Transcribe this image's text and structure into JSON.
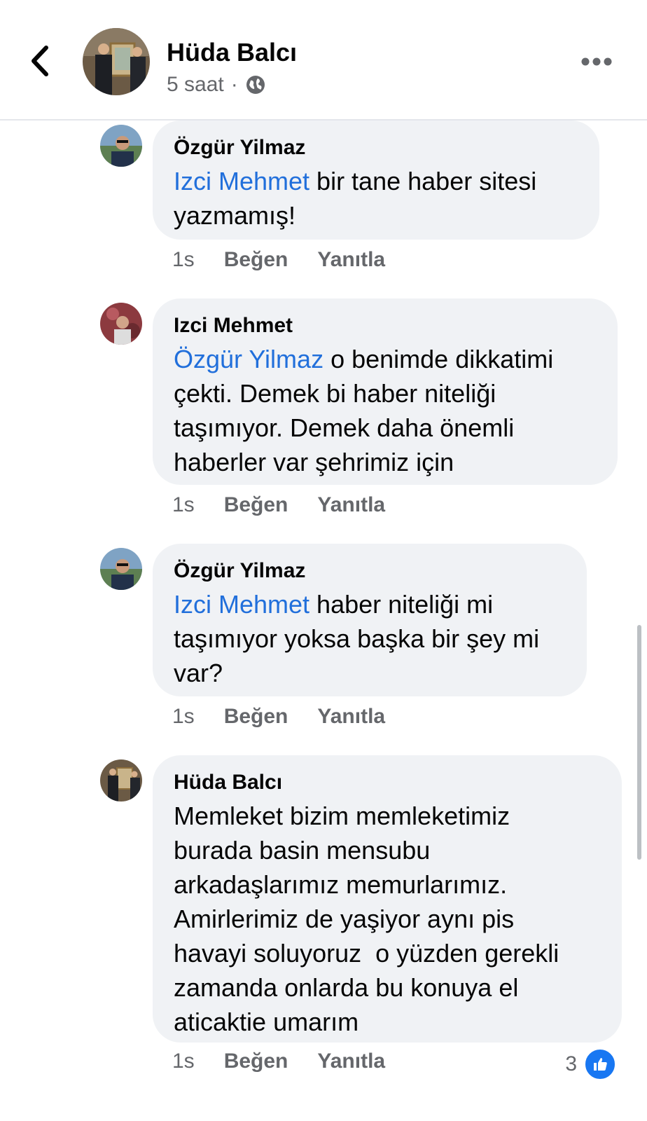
{
  "header": {
    "title": "Hüda Balcı",
    "time": "5 saat",
    "separator": "·",
    "privacy_icon": "globe-icon",
    "back_icon": "chevron-left-icon",
    "more_icon": "more-horizontal-icon"
  },
  "comments": [
    {
      "author": "Özgür Yilmaz",
      "mention": "Izci Mehmet",
      "text": " bir tane haber sitesi\nyazmamış!",
      "time": "1s",
      "like_label": "Beğen",
      "reply_label": "Yanıtla"
    },
    {
      "author": "Izci Mehmet",
      "mention": "Özgür Yilmaz",
      "text": " o benimde dikkatimi\nçekti. Demek bi haber niteliği\ntaşımıyor. Demek daha önemli\nhaberler var şehrimiz için",
      "time": "1s",
      "like_label": "Beğen",
      "reply_label": "Yanıtla"
    },
    {
      "author": "Özgür Yilmaz",
      "mention": "Izci Mehmet",
      "text": " haber niteliği mi\ntaşımıyor yoksa başka bir şey mi\nvar?",
      "time": "1s",
      "like_label": "Beğen",
      "reply_label": "Yanıtla"
    },
    {
      "author": "Hüda Balcı",
      "mention": "",
      "text": "Memleket bizim memleketimiz\nburada basin mensubu\narkadaşlarımız memurlarımız.\nAmirlerimiz de yaşiyor aynı pis\nhavayi soluyoruz  o yüzden gerekli\nzamanda onlarda bu konuya el\naticaktie umarım",
      "time": "1s",
      "like_label": "Beğen",
      "reply_label": "Yanıtla",
      "reaction_count": "3",
      "reaction_icon": "thumbs-up-icon"
    }
  ],
  "colors": {
    "mention": "#216fdb",
    "bubble": "#f0f2f5",
    "meta": "#65676b",
    "like_badge": "#1877f2"
  }
}
